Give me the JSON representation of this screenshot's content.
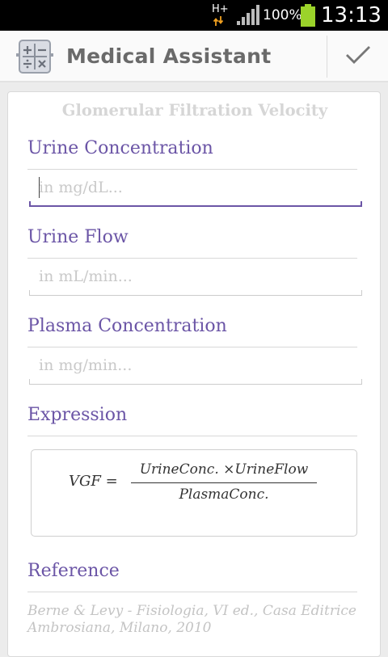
{
  "status_bar": {
    "network_type": "H+",
    "battery_percent": "100%",
    "time": "13:13",
    "icons": [
      "network-arrows-icon",
      "signal-icon",
      "battery-icon"
    ]
  },
  "action_bar": {
    "title": "Medical Assistant",
    "app_icon": "calculator-icon",
    "done_icon": "checkmark-icon"
  },
  "screen": {
    "title": "Glomerular Filtration Velocity",
    "fields": [
      {
        "label": "Urine Concentration",
        "placeholder": "in mg/dL...",
        "value": ""
      },
      {
        "label": "Urine Flow",
        "placeholder": "in mL/min...",
        "value": ""
      },
      {
        "label": "Plasma Concentration",
        "placeholder": "in mg/min...",
        "value": ""
      }
    ],
    "expression": {
      "label": "Expression",
      "lhs": "VGF =",
      "numerator": "UrineConc. ×UrineFlow",
      "denominator": "PlasmaConc."
    },
    "reference": {
      "label": "Reference",
      "text": "Berne & Levy - Fisiologia, VI ed., Casa Editrice Ambrosiana, Milano, 2010"
    }
  },
  "colors": {
    "accent": "#6b55a6",
    "title_text": "#6a6a6a",
    "placeholder": "#c9c9c9",
    "status_bar_bg": "#000000",
    "battery_green": "#9bd32a"
  }
}
